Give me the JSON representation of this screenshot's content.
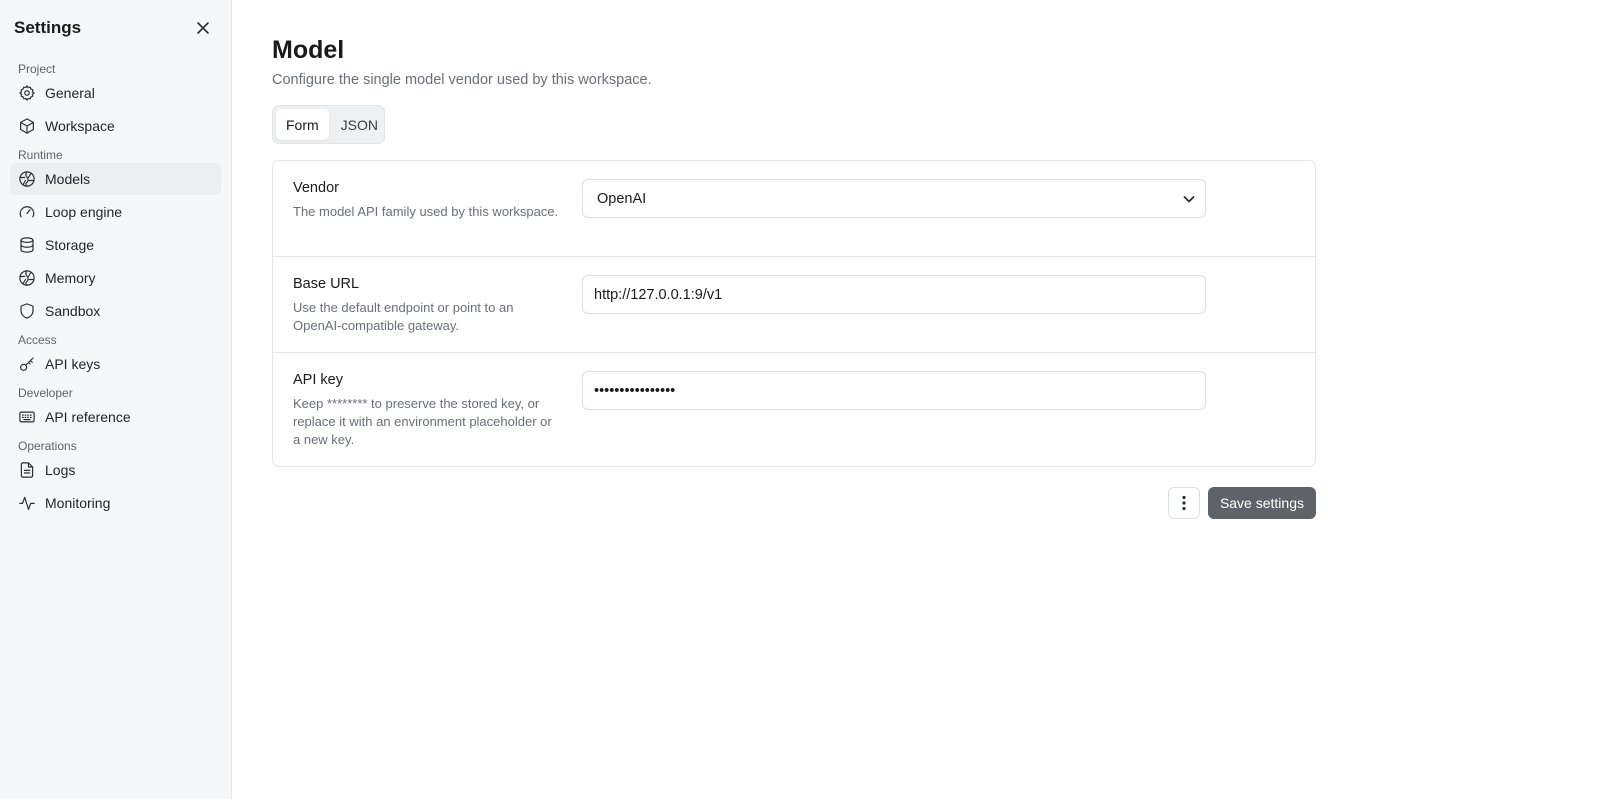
{
  "sidebar": {
    "title": "Settings",
    "sections": [
      {
        "label": "Project",
        "items": [
          {
            "label": "General",
            "icon": "gear-icon"
          },
          {
            "label": "Workspace",
            "icon": "cube-icon"
          }
        ]
      },
      {
        "label": "Runtime",
        "items": [
          {
            "label": "Models",
            "icon": "brain-icon",
            "active": true
          },
          {
            "label": "Loop engine",
            "icon": "gauge-icon"
          },
          {
            "label": "Storage",
            "icon": "database-icon"
          },
          {
            "label": "Memory",
            "icon": "brain-icon"
          },
          {
            "label": "Sandbox",
            "icon": "shield-icon"
          }
        ]
      },
      {
        "label": "Access",
        "items": [
          {
            "label": "API keys",
            "icon": "key-icon"
          }
        ]
      },
      {
        "label": "Developer",
        "items": [
          {
            "label": "API reference",
            "icon": "keyboard-icon"
          }
        ]
      },
      {
        "label": "Operations",
        "items": [
          {
            "label": "Logs",
            "icon": "file-text-icon"
          },
          {
            "label": "Monitoring",
            "icon": "activity-icon"
          }
        ]
      }
    ]
  },
  "main": {
    "title": "Model",
    "subtitle": "Configure the single model vendor used by this workspace.",
    "tabs": [
      {
        "label": "Form",
        "active": true
      },
      {
        "label": "JSON",
        "active": false
      }
    ],
    "fields": {
      "vendor": {
        "label": "Vendor",
        "description": "The model API family used by this workspace.",
        "value": "OpenAI"
      },
      "base_url": {
        "label": "Base URL",
        "description": "Use the default endpoint or point to an OpenAI-compatible gateway.",
        "value": "http://127.0.0.1:9/v1"
      },
      "api_key": {
        "label": "API key",
        "description": "Keep ******** to preserve the stored key, or replace it with an environment placeholder or a new key.",
        "value": "••••••••••••••••"
      }
    },
    "save_label": "Save settings"
  },
  "colors": {
    "sidebar_bg": "#f6f7f8",
    "active_item_bg": "#eceef0",
    "primary_button": "#5f6266"
  }
}
